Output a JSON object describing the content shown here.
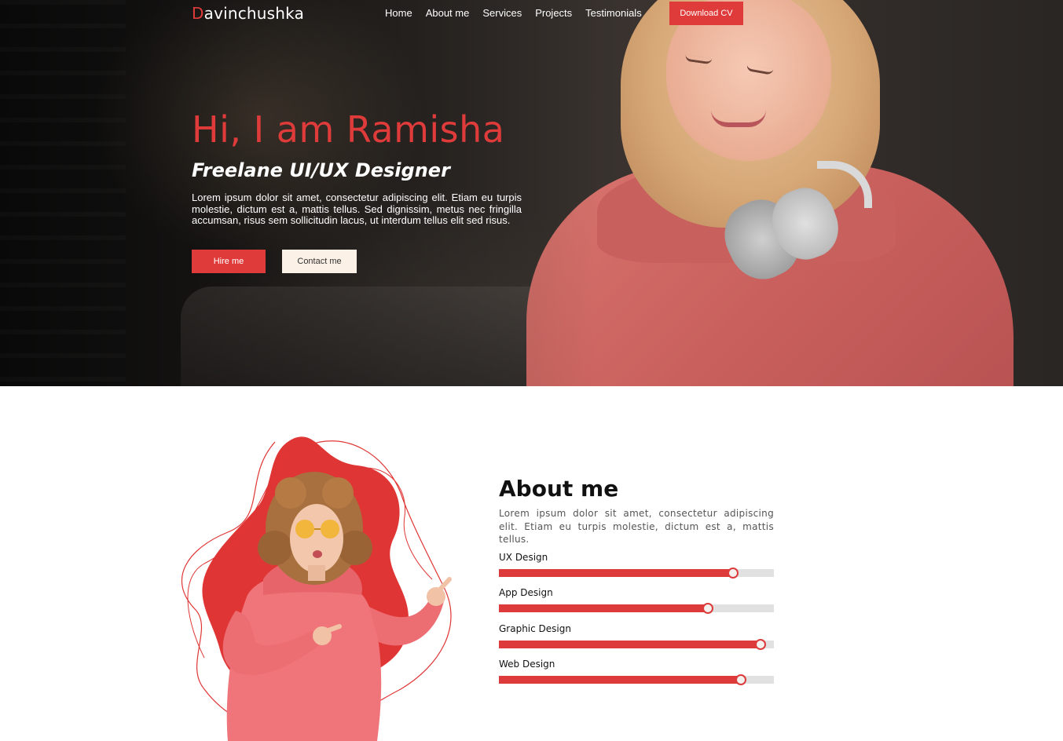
{
  "nav": {
    "logo_first": "D",
    "logo_rest": "avinchushka",
    "links": [
      "Home",
      "About me",
      "Services",
      "Projects",
      "Testimonials"
    ],
    "download_label": "Download CV"
  },
  "hero": {
    "title": "Hi, I am Ramisha",
    "subtitle": "Freelane UI/UX Designer",
    "text": "Lorem ipsum dolor sit amet, consectetur adipiscing elit. Etiam eu turpis molestie, dictum est a, mattis tellus. Sed dignissim, metus nec fringilla accumsan, risus sem sollicitudin lacus, ut interdum tellus elit sed risus.",
    "hire_label": "Hire me",
    "contact_label": "Contact me"
  },
  "about": {
    "heading": "About me",
    "text": "Lorem ipsum dolor sit amet, consectetur adipiscing elit. Etiam eu turpis molestie, dictum est a, mattis tellus.",
    "skills": [
      {
        "label": "UX Design",
        "percent": 85
      },
      {
        "label": "App Design",
        "percent": 76
      },
      {
        "label": "Graphic Design",
        "percent": 95
      },
      {
        "label": "Web Design",
        "percent": 88
      }
    ]
  },
  "colors": {
    "accent": "#e03b3b",
    "contact_button_bg": "#fbf1e6",
    "track": "#e1e1e1"
  }
}
